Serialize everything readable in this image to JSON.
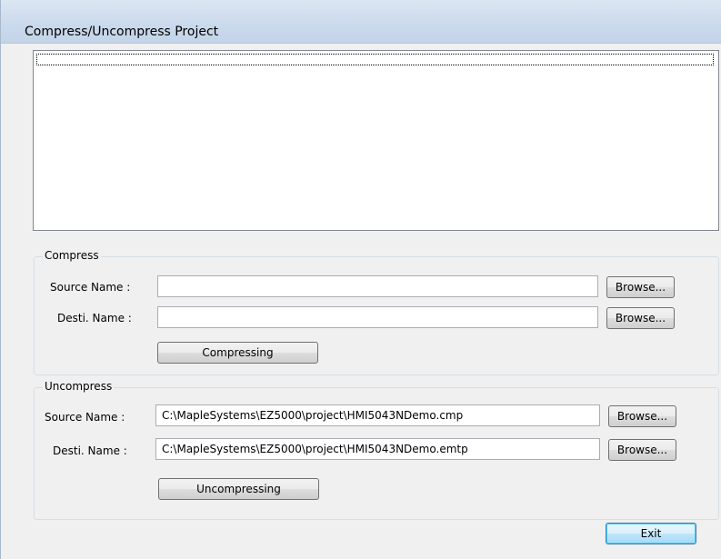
{
  "window": {
    "title": "Compress/Uncompress Project"
  },
  "log_list": {
    "items": []
  },
  "compress": {
    "group_label": "Compress",
    "source_label": "Source Name :",
    "source_value": "",
    "dest_label": "Desti. Name :",
    "dest_value": "",
    "browse_label": "Browse...",
    "action_label": "Compressing"
  },
  "uncompress": {
    "group_label": "Uncompress",
    "source_label": "Source Name :",
    "source_value": "C:\\MapleSystems\\EZ5000\\project\\HMI5043NDemo.cmp",
    "dest_label": "Desti. Name :",
    "dest_value": "C:\\MapleSystems\\EZ5000\\project\\HMI5043NDemo.emtp",
    "browse_label": "Browse...",
    "action_label": "Uncompressing"
  },
  "footer": {
    "exit_label": "Exit"
  }
}
